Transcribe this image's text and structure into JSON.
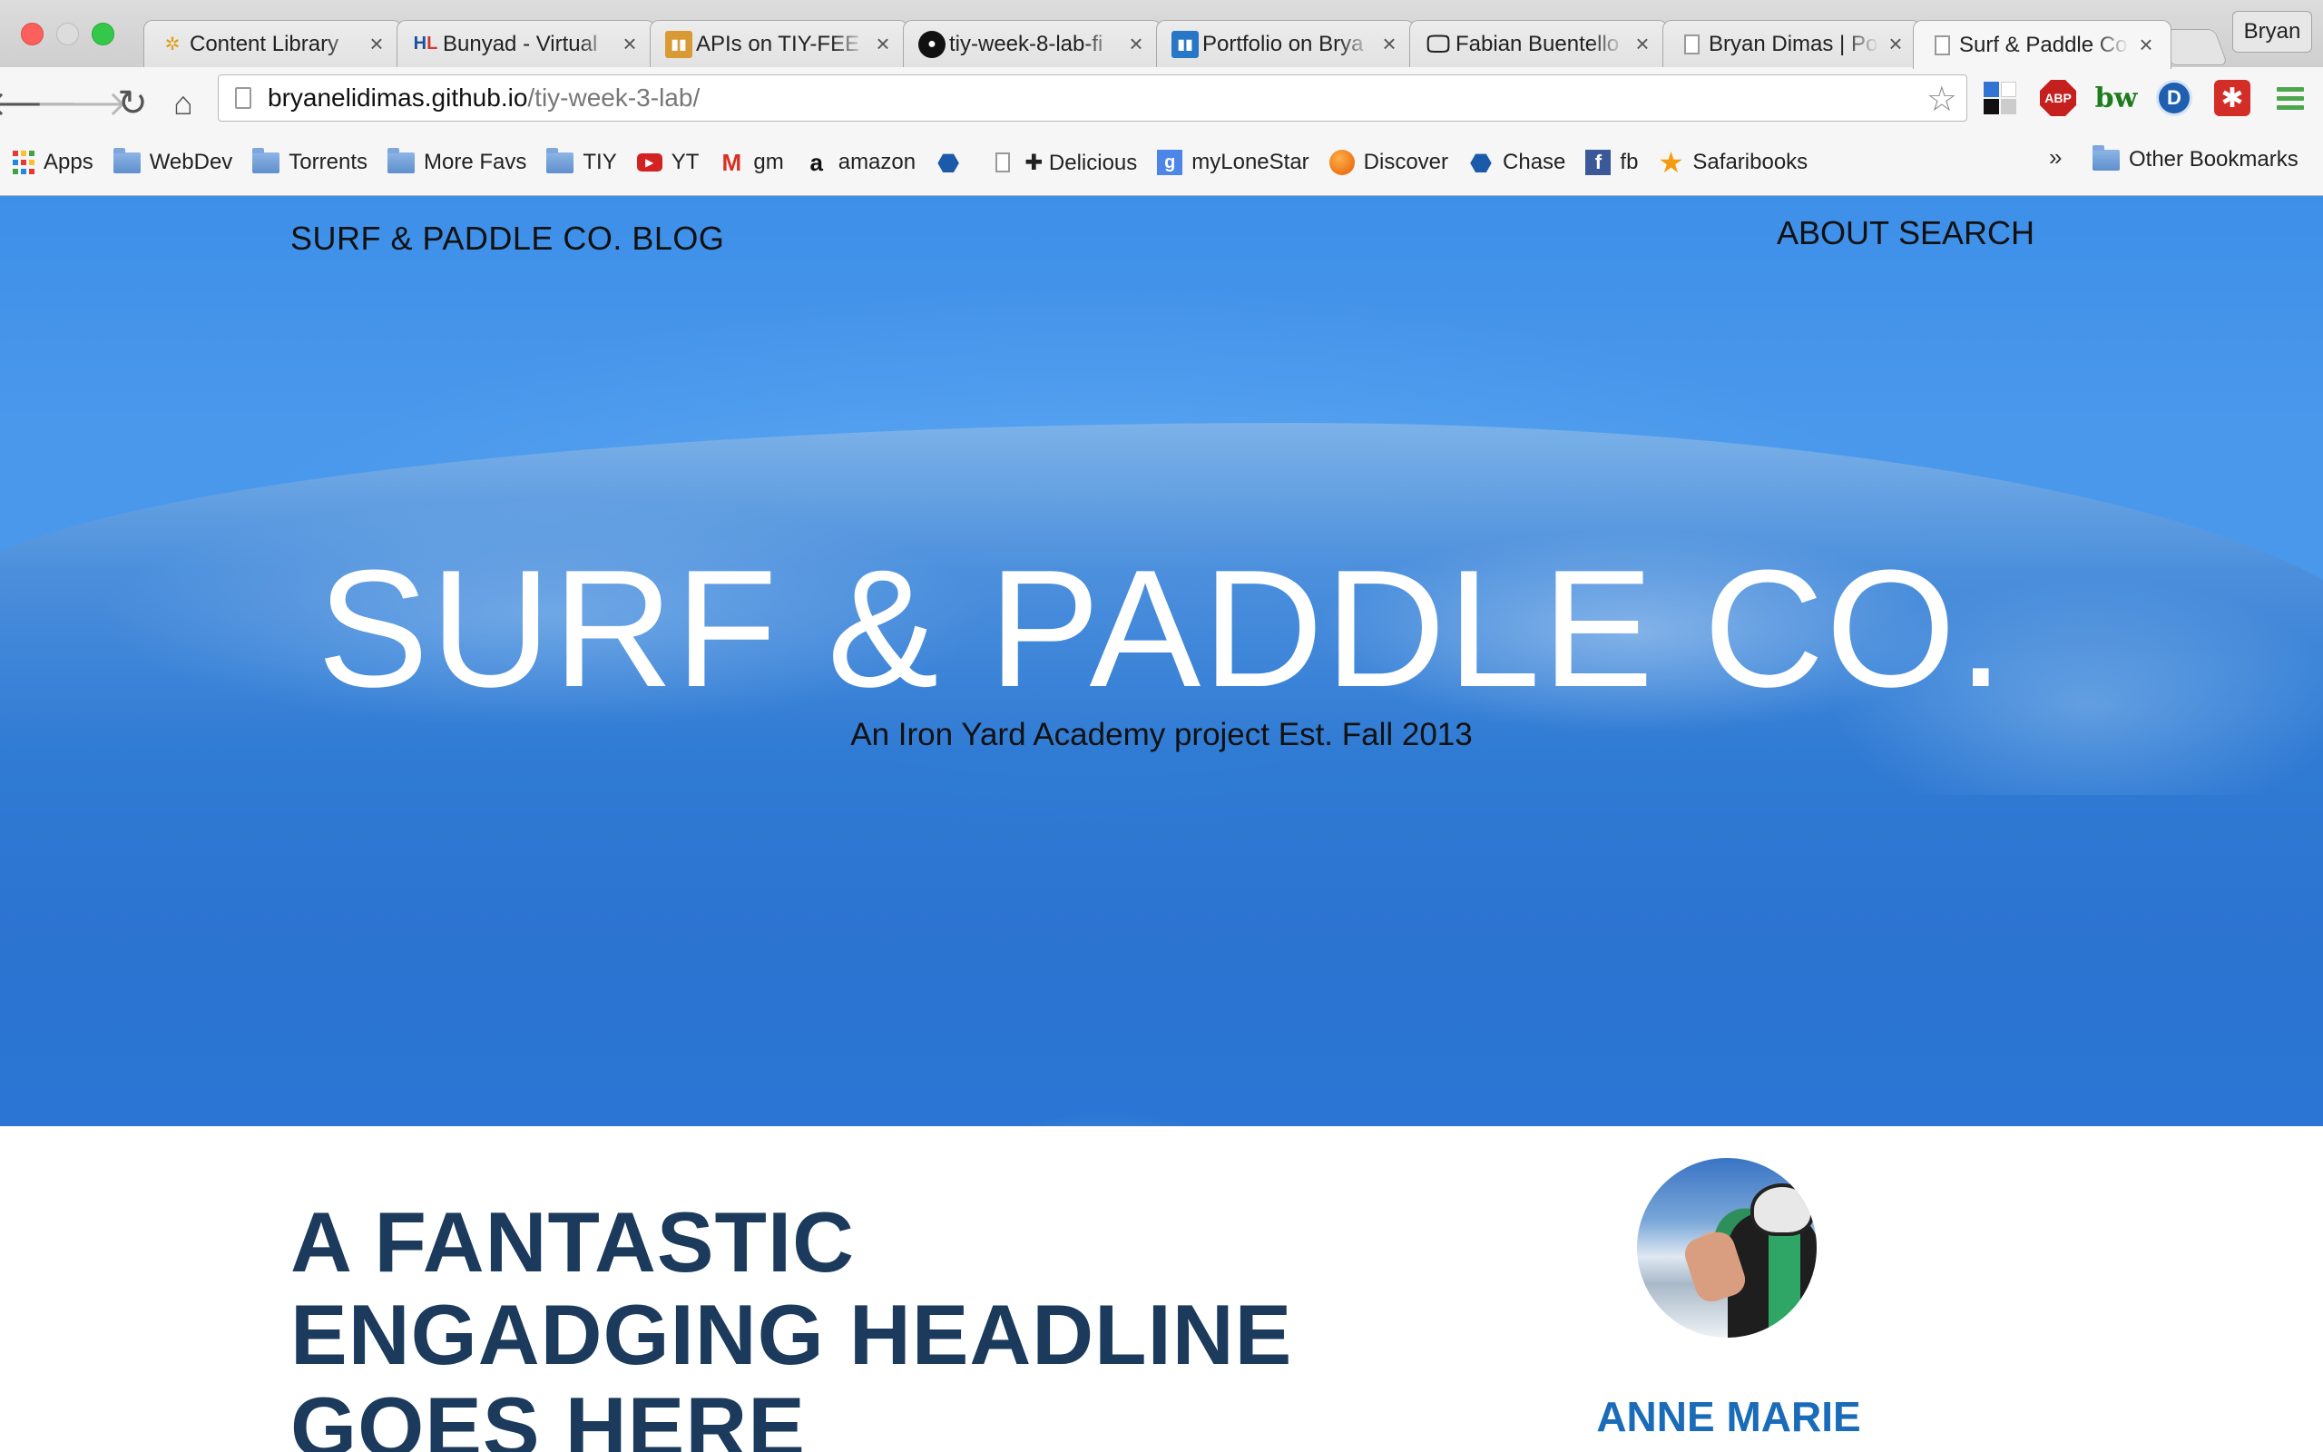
{
  "window": {
    "profile_name": "Bryan"
  },
  "tabs": [
    {
      "title": "Content Library",
      "favicon": "pinwheel-icon",
      "active": false
    },
    {
      "title": "Bunyad - Virtual",
      "favicon": "hl-logo-icon",
      "active": false
    },
    {
      "title": "APIs on TIY-FEE",
      "favicon": "trello-icon-orange",
      "active": false
    },
    {
      "title": "tiy-week-8-lab-fi",
      "favicon": "github-icon",
      "active": false
    },
    {
      "title": "Portfolio on Brya",
      "favicon": "trello-icon-blue",
      "active": false
    },
    {
      "title": "Fabian Buentello",
      "favicon": "monitor-icon",
      "active": false
    },
    {
      "title": "Bryan Dimas | Po",
      "favicon": "page-icon",
      "active": false
    },
    {
      "title": "Surf & Paddle Co",
      "favicon": "page-icon",
      "active": true
    }
  ],
  "address_bar": {
    "host": "bryanelidimas.github.io",
    "path": "/tiy-week-3-lab/"
  },
  "bookmarks": [
    {
      "label": "Apps",
      "icon": "apps-grid-icon"
    },
    {
      "label": "WebDev",
      "icon": "folder-icon"
    },
    {
      "label": "Torrents",
      "icon": "folder-icon"
    },
    {
      "label": "More Favs",
      "icon": "folder-icon"
    },
    {
      "label": "TIY",
      "icon": "folder-icon"
    },
    {
      "label": "YT",
      "icon": "youtube-icon"
    },
    {
      "label": "gm",
      "icon": "gmail-icon"
    },
    {
      "label": "amazon",
      "icon": "amazon-icon"
    },
    {
      "label": "",
      "icon": "chase-icon"
    },
    {
      "label": "✚ Delicious",
      "icon": "page-icon"
    },
    {
      "label": "myLoneStar",
      "icon": "google-icon"
    },
    {
      "label": "Discover",
      "icon": "discover-icon"
    },
    {
      "label": "Chase",
      "icon": "chase-icon"
    },
    {
      "label": "fb",
      "icon": "facebook-icon"
    },
    {
      "label": "Safaribooks",
      "icon": "star-icon"
    }
  ],
  "bookmarks_overflow": "»",
  "other_bookmarks": "Other Bookmarks",
  "site": {
    "brand": "SURF & PADDLE CO. BLOG",
    "nav": [
      "ABOUT",
      "SEARCH"
    ],
    "hero_title": "SURF & PADDLE CO.",
    "hero_subtitle": "An Iron Yard Academy project Est. Fall 2013",
    "headline": "A FANTASTIC ENGADGING HEADLINE GOES HERE",
    "author": "ANNE MARIE"
  },
  "colors": {
    "hero_blue": "#4a98ec",
    "headline_navy": "#1b3a5c",
    "author_blue": "#1a6bb8"
  }
}
